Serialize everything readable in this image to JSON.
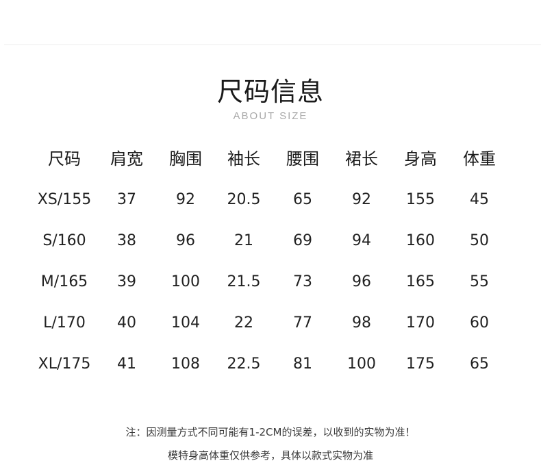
{
  "title": "尺码信息",
  "subtitle": "ABOUT SIZE",
  "table": {
    "headers": [
      "尺码",
      "肩宽",
      "胸围",
      "袖长",
      "腰围",
      "裙长",
      "身高",
      "体重"
    ],
    "rows": [
      [
        "XS/155",
        "37",
        "92",
        "20.5",
        "65",
        "92",
        "155",
        "45"
      ],
      [
        "S/160",
        "38",
        "96",
        "21",
        "69",
        "94",
        "160",
        "50"
      ],
      [
        "M/165",
        "39",
        "100",
        "21.5",
        "73",
        "96",
        "165",
        "55"
      ],
      [
        "L/170",
        "40",
        "104",
        "22",
        "77",
        "98",
        "170",
        "60"
      ],
      [
        "XL/175",
        "41",
        "108",
        "22.5",
        "81",
        "100",
        "175",
        "65"
      ]
    ]
  },
  "notes": {
    "line1": "注：因测量方式不同可能有1-2CM的误差，以收到的实物为准！",
    "line2": "模特身高体重仅供参考，具体以款式实物为准"
  }
}
